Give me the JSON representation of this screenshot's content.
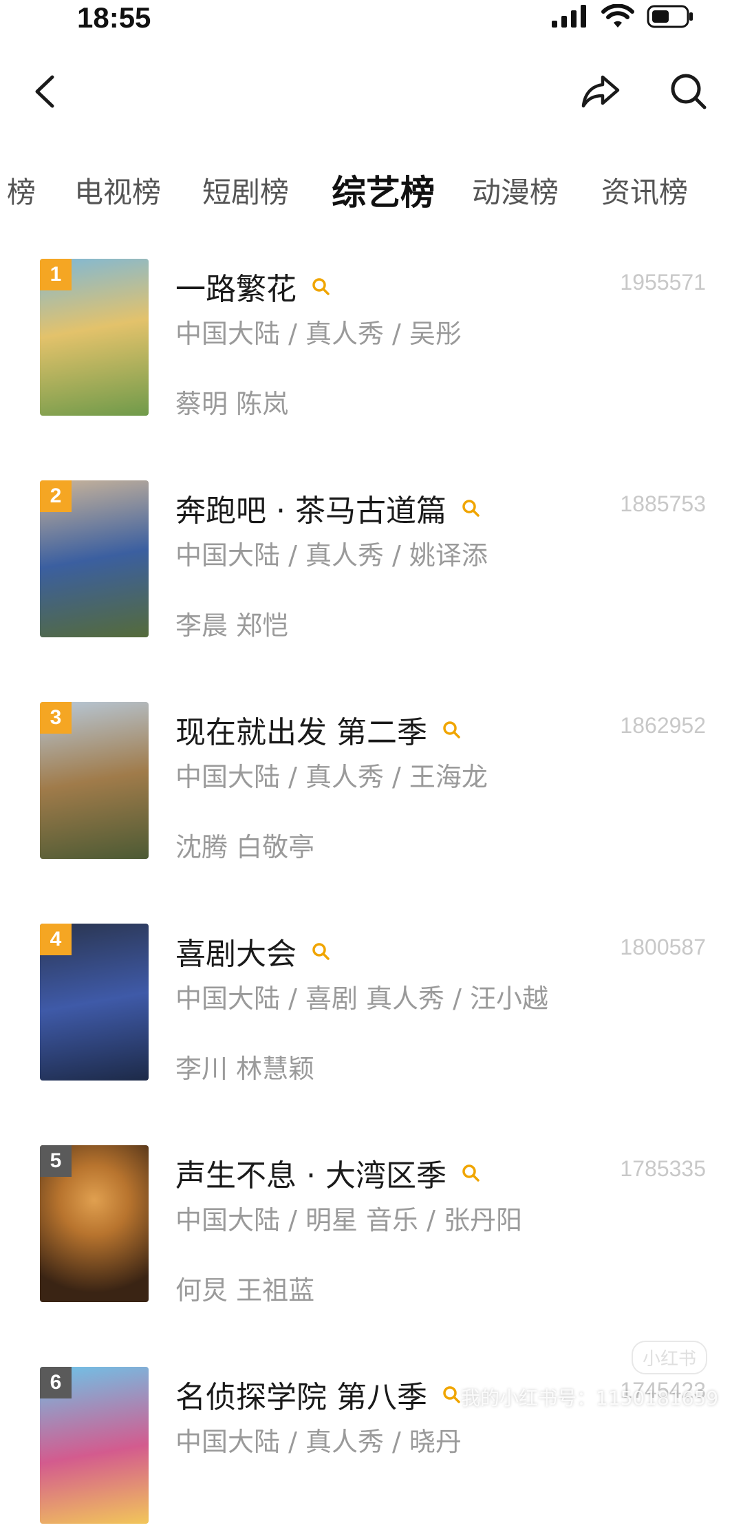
{
  "status_bar": {
    "time": "18:55"
  },
  "tabs": [
    {
      "label": "榜",
      "active": false
    },
    {
      "label": "电视榜",
      "active": false
    },
    {
      "label": "短剧榜",
      "active": false
    },
    {
      "label": "综艺榜",
      "active": true
    },
    {
      "label": "动漫榜",
      "active": false
    },
    {
      "label": "资讯榜",
      "active": false
    }
  ],
  "shows": [
    {
      "rank": "1",
      "title": "一路繁花",
      "count": "1955571",
      "meta": "中国大陆 / 真人秀 / 吴彤",
      "cast": "蔡明 陈岚",
      "colors": [
        "#7fb8d6",
        "#e3c26b",
        "#6f9a4a"
      ]
    },
    {
      "rank": "2",
      "title": "奔跑吧 · 茶马古道篇",
      "count": "1885753",
      "meta": "中国大陆 / 真人秀 / 姚译添",
      "cast": "李晨 郑恺",
      "colors": [
        "#c9b49a",
        "#3b5fa0",
        "#556b3a"
      ]
    },
    {
      "rank": "3",
      "title": "现在就出发 第二季",
      "count": "1862952",
      "meta": "中国大陆 / 真人秀 / 王海龙",
      "cast": "沈腾 白敬亭",
      "colors": [
        "#b7c8d8",
        "#a07b4a",
        "#4c5a34"
      ]
    },
    {
      "rank": "4",
      "title": "喜剧大会",
      "count": "1800587",
      "meta": "中国大陆 / 喜剧 真人秀 / 汪小越",
      "cast": "李川 林慧颖",
      "colors": [
        "#2a3550",
        "#3f5aa8",
        "#1d2a48"
      ]
    },
    {
      "rank": "5",
      "title": "声生不息 · 大湾区季",
      "count": "1785335",
      "meta": "中国大陆 / 明星 音乐 / 张丹阳",
      "cast": "何炅 王祖蓝",
      "colors": [
        "#2b1a10",
        "#b8742e",
        "#3a2414"
      ]
    },
    {
      "rank": "6",
      "title": "名侦探学院 第八季",
      "count": "1745423",
      "meta": "中国大陆 / 真人秀 / 晓丹",
      "cast": "",
      "colors": [
        "#6ec3e8",
        "#d35b8e",
        "#f2c65a"
      ]
    }
  ],
  "watermark": {
    "text": "我的小红书号：1150181659",
    "logo": "小红书"
  },
  "accent": "#f5a623"
}
